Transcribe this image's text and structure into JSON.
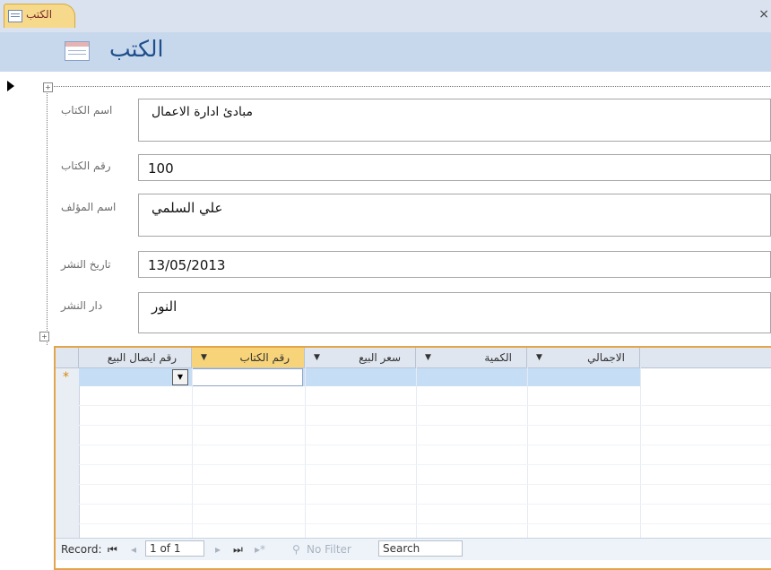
{
  "tab": {
    "label": "الكتب",
    "close": "×"
  },
  "form": {
    "title": "الكتب"
  },
  "fields": [
    {
      "label": "اسم الكتاب",
      "value": "مبادئ ادارة الاعمال"
    },
    {
      "label": "رقم الكتاب",
      "value": "100"
    },
    {
      "label": "اسم المؤلف",
      "value": "علي السلمي"
    },
    {
      "label": "تاريخ النشر",
      "value": "13/05/2013"
    },
    {
      "label": "دار النشر",
      "value": "النور"
    }
  ],
  "subform": {
    "columns": [
      "رقم ايصال البيع",
      "رقم الكتاب",
      "سعر البيع",
      "الكمية",
      "الاجمالي"
    ],
    "new_row_marker": "*"
  },
  "nav": {
    "record_label": "Record:",
    "first": "⏮",
    "prev": "◂",
    "position": "1 of 1",
    "next": "▸",
    "last": "⏭",
    "new": "▸*",
    "filter": "No Filter",
    "search": "Search"
  }
}
